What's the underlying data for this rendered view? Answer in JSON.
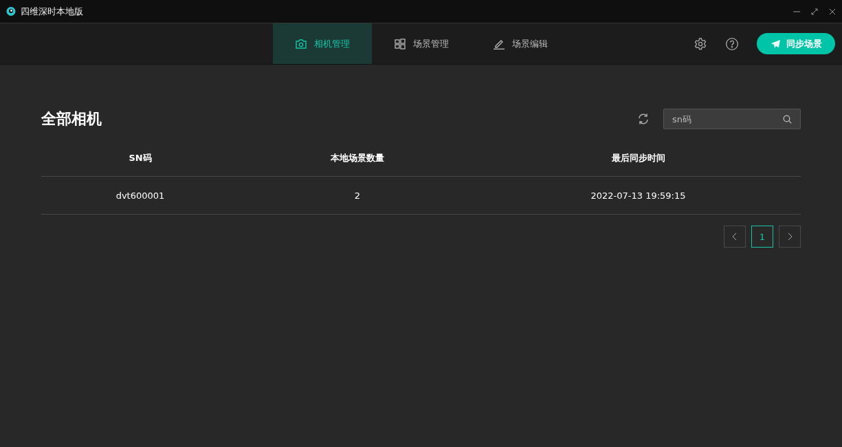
{
  "window": {
    "title": "四维深时本地版"
  },
  "tabs": [
    {
      "label": "相机管理",
      "selected": true
    },
    {
      "label": "场景管理",
      "selected": false
    },
    {
      "label": "场景编辑",
      "selected": false
    }
  ],
  "sync_button": {
    "label": "同步场景"
  },
  "page": {
    "heading": "全部相机",
    "search": {
      "placeholder": "sn码"
    }
  },
  "table": {
    "columns": [
      "SN码",
      "本地场景数量",
      "最后同步时间"
    ],
    "rows": [
      [
        "dvt600001",
        "2",
        "2022-07-13 19:59:15"
      ]
    ]
  },
  "pagination": {
    "pages": [
      {
        "label": "1",
        "selected": true
      }
    ]
  }
}
